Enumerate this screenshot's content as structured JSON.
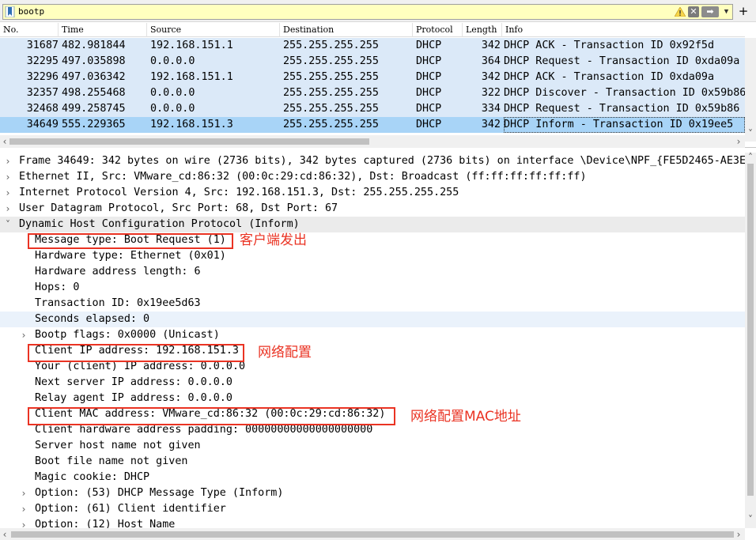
{
  "filter": {
    "value": "bootp"
  },
  "packet_list": {
    "columns": [
      "No.",
      "Time",
      "Source",
      "Destination",
      "Protocol",
      "Length",
      "Info"
    ],
    "rows": [
      {
        "no": "31687",
        "time": "482.981844",
        "src": "192.168.151.1",
        "dst": "255.255.255.255",
        "proto": "DHCP",
        "len": "342",
        "info": "DHCP ACK      - Transaction ID 0x92f5d"
      },
      {
        "no": "32295",
        "time": "497.035898",
        "src": "0.0.0.0",
        "dst": "255.255.255.255",
        "proto": "DHCP",
        "len": "364",
        "info": "DHCP Request  - Transaction ID 0xda09a"
      },
      {
        "no": "32296",
        "time": "497.036342",
        "src": "192.168.151.1",
        "dst": "255.255.255.255",
        "proto": "DHCP",
        "len": "342",
        "info": "DHCP ACK      - Transaction ID 0xda09a"
      },
      {
        "no": "32357",
        "time": "498.255468",
        "src": "0.0.0.0",
        "dst": "255.255.255.255",
        "proto": "DHCP",
        "len": "322",
        "info": "DHCP Discover - Transaction ID 0x59b86"
      },
      {
        "no": "32468",
        "time": "499.258745",
        "src": "0.0.0.0",
        "dst": "255.255.255.255",
        "proto": "DHCP",
        "len": "334",
        "info": "DHCP Request  - Transaction ID 0x59b86"
      },
      {
        "no": "34649",
        "time": "555.229365",
        "src": "192.168.151.3",
        "dst": "255.255.255.255",
        "proto": "DHCP",
        "len": "342",
        "info": "DHCP Inform   - Transaction ID 0x19ee5"
      }
    ]
  },
  "details": {
    "frame": "Frame 34649: 342 bytes on wire (2736 bits), 342 bytes captured (2736 bits) on interface \\Device\\NPF_{FE5D2465-AE3E-",
    "ethernet": "Ethernet II, Src: VMware_cd:86:32 (00:0c:29:cd:86:32), Dst: Broadcast (ff:ff:ff:ff:ff:ff)",
    "ip": "Internet Protocol Version 4, Src: 192.168.151.3, Dst: 255.255.255.255",
    "udp": "User Datagram Protocol, Src Port: 68, Dst Port: 67",
    "dhcp": "Dynamic Host Configuration Protocol (Inform)",
    "dhcp_fields": [
      "Message type: Boot Request (1)",
      "Hardware type: Ethernet (0x01)",
      "Hardware address length: 6",
      "Hops: 0",
      "Transaction ID: 0x19ee5d63",
      "Seconds elapsed: 0",
      "Bootp flags: 0x0000 (Unicast)",
      "Client IP address: 192.168.151.3",
      "Your (client) IP address: 0.0.0.0",
      "Next server IP address: 0.0.0.0",
      "Relay agent IP address: 0.0.0.0",
      "Client MAC address: VMware_cd:86:32 (00:0c:29:cd:86:32)",
      "Client hardware address padding: 00000000000000000000",
      "Server host name not given",
      "Boot file name not given",
      "Magic cookie: DHCP",
      "Option: (53) DHCP Message Type (Inform)",
      "Option: (61) Client identifier",
      "Option: (12) Host Name"
    ]
  },
  "annotations": {
    "client_sent": "客户端发出",
    "network_config": "网络配置",
    "network_config_mac": "网络配置MAC地址"
  },
  "colors": {
    "annotation": "#ea3323",
    "row_bg": "#dbe9f8",
    "row_selected": "#a8d4f7",
    "filter_bg": "#ffffbf"
  }
}
